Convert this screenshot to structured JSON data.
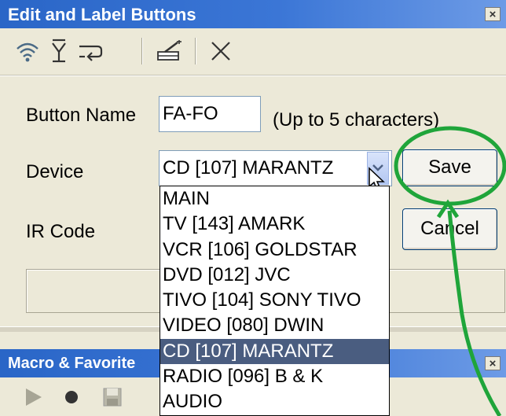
{
  "window": {
    "title": "Edit and Label Buttons",
    "close_glyph": "×"
  },
  "toolbar": {
    "icons": [
      "wifi-icon",
      "download-icon",
      "wrap-icon",
      "magic-pencil-icon",
      "delete-x-icon"
    ]
  },
  "form": {
    "button_name_label": "Button Name",
    "button_name_value": "FA-FO",
    "button_name_hint": "(Up to 5 characters)",
    "device_label": "Device",
    "device_selected": "CD [107] MARANTZ",
    "ir_code_label": "IR Code",
    "save_label": "Save",
    "cancel_label": "Cancel"
  },
  "device_options": [
    "MAIN",
    "TV [143] AMARK",
    "VCR [106] GOLDSTAR",
    "DVD [012] JVC",
    "TIVO [104] SONY TIVO",
    "VIDEO [080] DWIN",
    "CD [107] MARANTZ",
    "RADIO [096] B & K",
    "AUDIO"
  ],
  "macro_panel": {
    "title": "Macro & Favorite",
    "close_glyph": "×",
    "icons": [
      "play-icon",
      "record-icon",
      "save-icon"
    ]
  },
  "annotation": {
    "color": "#1fa53a"
  }
}
